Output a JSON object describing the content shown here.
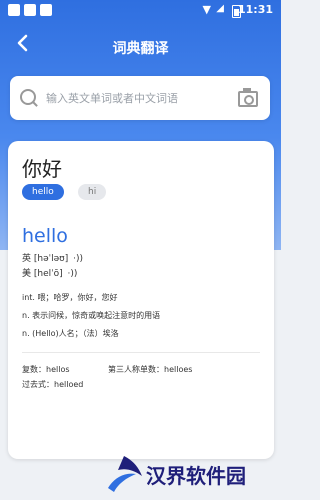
{
  "status_bar": {
    "time": "11:31"
  },
  "header": {
    "title": "词典翻译"
  },
  "search": {
    "placeholder": "输入英文单词或者中文词语"
  },
  "result": {
    "chinese_word": "你好",
    "chips": [
      {
        "label": "hello",
        "selected": true
      },
      {
        "label": "hi",
        "selected": false
      }
    ],
    "english_word": "hello",
    "pronunciations": [
      {
        "region": "英",
        "phonetic": "[həˈləʊ]"
      },
      {
        "region": "美",
        "phonetic": "[helˈō]"
      }
    ],
    "definitions": [
      "int. 喂；哈罗，你好，您好",
      "n. 表示问候，惊奇或唤起注意时的用语",
      "n. (Hello)人名；（法）埃洛"
    ],
    "forms": [
      {
        "label": "复数：",
        "value": "hellos"
      },
      {
        "label": "第三人称单数：",
        "value": "helloes"
      },
      {
        "label": "过去式：",
        "value": "helloed"
      }
    ]
  },
  "watermark": {
    "text": "汉界软件园"
  },
  "colors": {
    "primary": "#2f6fe0",
    "background": "#eef1f5"
  }
}
